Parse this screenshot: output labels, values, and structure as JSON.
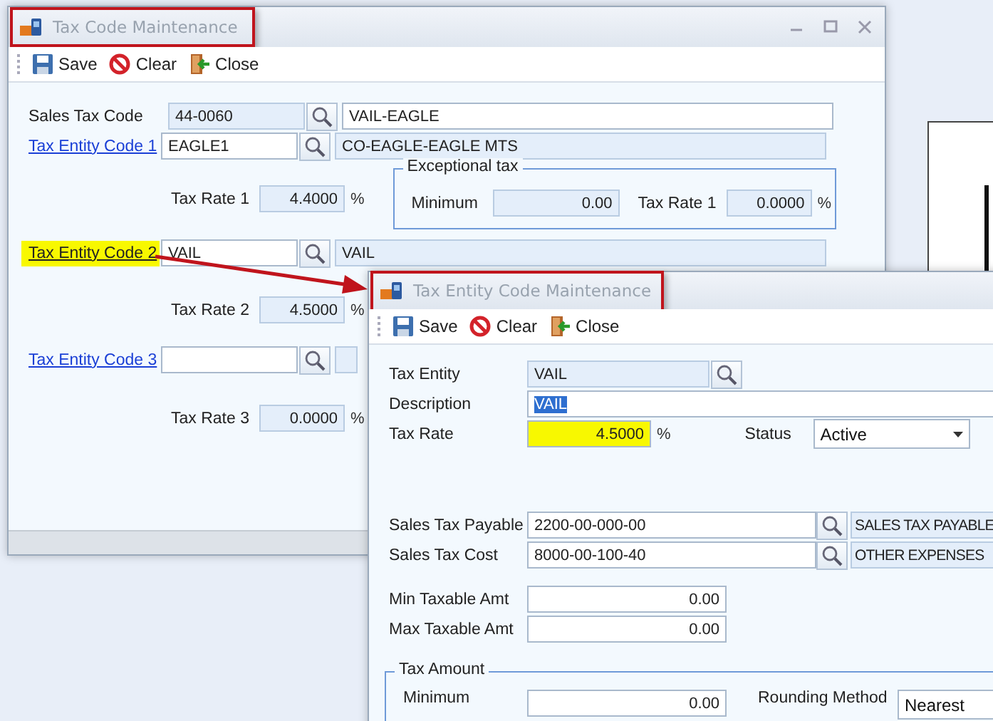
{
  "tax_code_window": {
    "title": "Tax Code Maintenance",
    "title_boxed": true,
    "toolbar": [
      {
        "kind": "save",
        "label": "Save"
      },
      {
        "kind": "clear",
        "label": "Clear"
      },
      {
        "kind": "close",
        "label": "Close"
      }
    ],
    "sales_tax_code": {
      "label": "Sales Tax Code",
      "code": "44-0060",
      "description": "VAIL-EAGLE"
    },
    "entities": [
      {
        "label": "Tax Entity Code 1",
        "highlighted": false,
        "code": "EAGLE1",
        "description": "CO-EAGLE-EAGLE MTS",
        "rate_label": "Tax Rate 1",
        "rate": "4.4000",
        "unit": "%"
      },
      {
        "label": "Tax Entity Code 2",
        "highlighted": true,
        "code": "VAIL",
        "description": "VAIL",
        "rate_label": "Tax Rate 2",
        "rate": "4.5000",
        "unit": "%"
      },
      {
        "label": "Tax Entity Code 3",
        "highlighted": false,
        "rate_label": "Tax Rate 3",
        "rate": "0.0000",
        "unit": "%"
      }
    ],
    "exceptional_tax": {
      "title": "Exceptional tax",
      "minimum_label": "Minimum",
      "minimum": "0.00",
      "rate_label": "Tax Rate 1",
      "rate": "0.0000",
      "unit": "%"
    }
  },
  "tax_entity_window": {
    "title": "Tax Entity Code Maintenance",
    "title_boxed": true,
    "toolbar": [
      {
        "kind": "save",
        "label": "Save"
      },
      {
        "kind": "clear",
        "label": "Clear"
      },
      {
        "kind": "close",
        "label": "Close"
      }
    ],
    "tax_entity": {
      "label": "Tax Entity",
      "value": "VAIL"
    },
    "description": {
      "label": "Description",
      "value": "VAIL",
      "text_selected": true
    },
    "tax_rate": {
      "label": "Tax Rate",
      "value": "4.5000",
      "unit": "%",
      "highlighted": true
    },
    "status": {
      "label": "Status",
      "value": "Active"
    },
    "accounts": [
      {
        "label": "Sales Tax Payable",
        "account": "2200-00-000-00",
        "description": "SALES TAX PAYABLE"
      },
      {
        "label": "Sales Tax Cost",
        "account": "8000-00-100-40",
        "description": "OTHER EXPENSES"
      }
    ],
    "taxable_amounts": [
      {
        "label": "Min Taxable Amt",
        "value": "0.00"
      },
      {
        "label": "Max Taxable Amt",
        "value": "0.00"
      }
    ],
    "tax_amount": {
      "title": "Tax Amount",
      "minimum_label": "Minimum",
      "minimum": "0.00",
      "rounding_label": "Rounding Method",
      "rounding": "Nearest"
    }
  }
}
